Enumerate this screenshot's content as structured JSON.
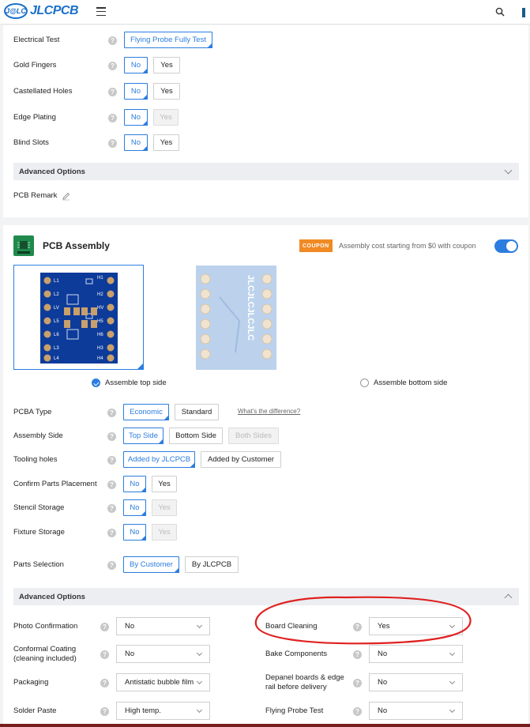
{
  "header": {
    "logo_mark": "J@LC",
    "logo_text": "JLCPCB"
  },
  "pcb_options": [
    {
      "label": "Electrical Test",
      "options": [
        {
          "text": "Flying Probe Fully Test",
          "state": "selected"
        }
      ]
    },
    {
      "label": "Gold Fingers",
      "options": [
        {
          "text": "No",
          "state": "selected"
        },
        {
          "text": "Yes",
          "state": "normal"
        }
      ]
    },
    {
      "label": "Castellated Holes",
      "options": [
        {
          "text": "No",
          "state": "selected"
        },
        {
          "text": "Yes",
          "state": "normal"
        }
      ]
    },
    {
      "label": "Edge Plating",
      "options": [
        {
          "text": "No",
          "state": "selected"
        },
        {
          "text": "Yes",
          "state": "disabled"
        }
      ]
    },
    {
      "label": "Blind Slots",
      "options": [
        {
          "text": "No",
          "state": "selected"
        },
        {
          "text": "Yes",
          "state": "normal"
        }
      ]
    }
  ],
  "advanced_options_label": "Advanced Options",
  "pcb_remark_label": "PCB Remark",
  "assembly": {
    "title": "PCB Assembly",
    "coupon_badge": "COUPON",
    "coupon_text": "Assembly cost starting from $0 with coupon",
    "toggle_on": true,
    "top_side_label": "Assemble top side",
    "bottom_side_label": "Assemble bottom side",
    "pcb_top_labels": [
      "L1",
      "L2",
      "LV",
      "L5",
      "L6",
      "L3",
      "L4",
      "H1",
      "H2",
      "HV",
      "H5",
      "H6",
      "H3",
      "H4"
    ],
    "pcb_bottom_text": "JLCJLCJLCJLC",
    "whats_difference": "What's the difference?",
    "rows": [
      {
        "label": "PCBA Type",
        "options": [
          {
            "text": "Economic",
            "state": "selected"
          },
          {
            "text": "Standard",
            "state": "normal"
          }
        ]
      },
      {
        "label": "Assembly Side",
        "options": [
          {
            "text": "Top Side",
            "state": "selected"
          },
          {
            "text": "Bottom Side",
            "state": "normal"
          },
          {
            "text": "Both Sides",
            "state": "disabled"
          }
        ]
      },
      {
        "label": "Tooling holes",
        "options": [
          {
            "text": "Added by JLCPCB",
            "state": "selected"
          },
          {
            "text": "Added by Customer",
            "state": "normal"
          }
        ]
      },
      {
        "label": "Confirm Parts Placement",
        "options": [
          {
            "text": "No",
            "state": "selected"
          },
          {
            "text": "Yes",
            "state": "normal"
          }
        ]
      },
      {
        "label": "Stencil Storage",
        "options": [
          {
            "text": "No",
            "state": "selected"
          },
          {
            "text": "Yes",
            "state": "disabled"
          }
        ]
      },
      {
        "label": "Fixture Storage",
        "options": [
          {
            "text": "No",
            "state": "selected"
          },
          {
            "text": "Yes",
            "state": "disabled"
          }
        ]
      },
      {
        "label": "Parts Selection",
        "options": [
          {
            "text": "By Customer",
            "state": "selected"
          },
          {
            "text": "By JLCPCB",
            "state": "normal"
          }
        ]
      }
    ],
    "advanced": {
      "label": "Advanced Options",
      "left": [
        {
          "label": "Photo Confirmation",
          "value": "No"
        },
        {
          "label": "Conformal Coating\n(cleaning included)",
          "value": "No"
        },
        {
          "label": "Packaging",
          "value": "Antistatic bubble film"
        },
        {
          "label": "Solder Paste",
          "value": "High temp."
        }
      ],
      "right": [
        {
          "label": "Board Cleaning",
          "value": "Yes"
        },
        {
          "label": "Bake Components",
          "value": "No"
        },
        {
          "label": "Depanel boards & edge\nrail before delivery",
          "value": "No"
        },
        {
          "label": "Flying Probe Test",
          "value": "No"
        }
      ]
    }
  },
  "colors": {
    "accent": "#2b7de0",
    "brand": "#1a6fc9",
    "coupon": "#f08a24",
    "annotation": "#e02020"
  }
}
